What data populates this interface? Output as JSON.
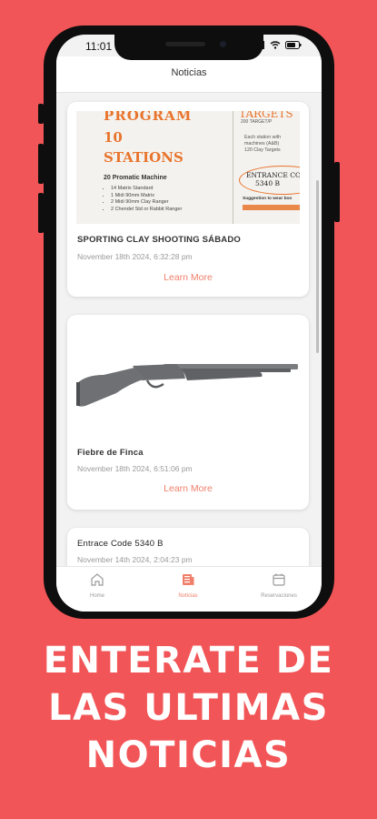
{
  "status": {
    "time": "11:01"
  },
  "header": {
    "title": "Noticias"
  },
  "posts": [
    {
      "title": "SPORTING CLAY SHOOTING SÁBADO",
      "date": "November 18th 2024, 6:32:28 pm",
      "link": "Learn More",
      "flyer": {
        "program": "PROGRAM",
        "stations": "10 STATIONS",
        "machine_heading": "20 Promatic Machine",
        "machines": [
          "14 Matrix Standard",
          "1 Midi 90mm Matrix",
          "2 Midi 90mm Clay Ranger",
          "2 Chendel Std or Rabbit Ranger"
        ],
        "targets": "TARGETS",
        "targets_sub": "200 TARGET/P",
        "right_list": [
          "Each station with",
          "machines (A&B)",
          "120 Clay Targets"
        ],
        "entrance_line1": "ENTRANCE CO",
        "entrance_line2": "5340 B",
        "suggestion": "Suggestion to wear boo"
      }
    },
    {
      "title": "Fiebre de Finca",
      "date": "November 18th 2024, 6:51:06 pm",
      "link": "Learn More"
    },
    {
      "title": "Entrace Code 5340 B",
      "date": "November 14th 2024, 2:04:23 pm"
    }
  ],
  "tabs": [
    {
      "label": "Home",
      "icon": "home-icon"
    },
    {
      "label": "Noticias",
      "icon": "news-icon"
    },
    {
      "label": "Reservaciones",
      "icon": "calendar-icon"
    }
  ],
  "promo": {
    "line1": "ENTERATE DE",
    "line2": "LAS ULTIMAS",
    "line3": "NOTICIAS"
  },
  "colors": {
    "background": "#f25557",
    "accent": "#f07f6a",
    "flyer_orange": "#e8742d"
  }
}
